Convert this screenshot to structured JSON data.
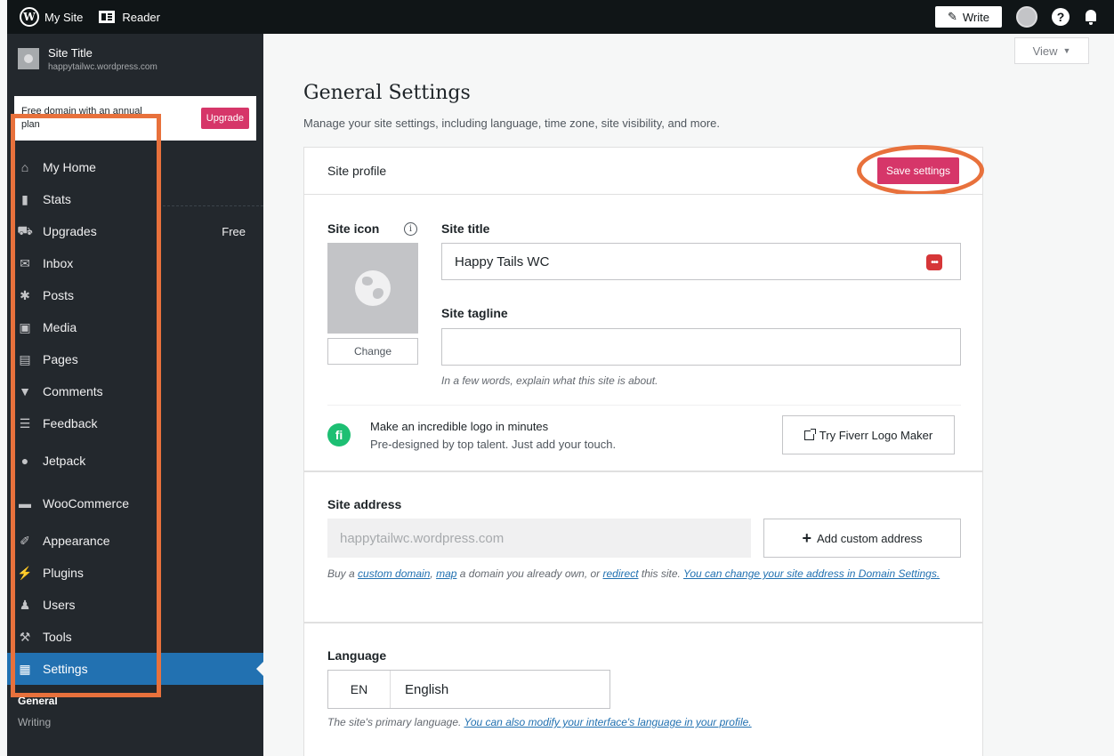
{
  "topbar": {
    "my_site": "My Site",
    "reader": "Reader",
    "write": "Write"
  },
  "site": {
    "title": "Site Title",
    "url": "happytailwc.wordpress.com"
  },
  "promo": {
    "text": "Free domain with an annual plan",
    "button": "Upgrade"
  },
  "menu": {
    "items": [
      {
        "label": "My Home",
        "icon": "home-icon"
      },
      {
        "label": "Stats",
        "icon": "stats-icon"
      },
      {
        "label": "Upgrades",
        "icon": "cart-icon",
        "badge": "Free"
      },
      {
        "label": "Inbox",
        "icon": "mail-icon"
      },
      {
        "label": "Posts",
        "icon": "pin-icon"
      },
      {
        "label": "Media",
        "icon": "media-icon"
      },
      {
        "label": "Pages",
        "icon": "pages-icon"
      },
      {
        "label": "Comments",
        "icon": "comment-icon"
      },
      {
        "label": "Feedback",
        "icon": "feedback-icon"
      },
      {
        "label": "Jetpack",
        "icon": "jetpack-icon"
      },
      {
        "label": "WooCommerce",
        "icon": "woo-icon"
      },
      {
        "label": "Appearance",
        "icon": "brush-icon"
      },
      {
        "label": "Plugins",
        "icon": "plug-icon"
      },
      {
        "label": "Users",
        "icon": "user-icon"
      },
      {
        "label": "Tools",
        "icon": "wrench-icon"
      },
      {
        "label": "Settings",
        "icon": "settings-icon"
      }
    ],
    "submenu": [
      "General",
      "Writing"
    ]
  },
  "main": {
    "view_button": "View",
    "title": "General Settings",
    "subtitle": "Manage your site settings, including language, time zone, site visibility, and more.",
    "profile_header": "Site profile",
    "save_button": "Save settings",
    "site_icon_label": "Site icon",
    "change_button": "Change",
    "site_title_label": "Site title",
    "site_title_value": "Happy Tails WC",
    "site_tagline_label": "Site tagline",
    "site_tagline_value": "",
    "tagline_hint": "In a few words, explain what this site is about.",
    "fiverr": {
      "title": "Make an incredible logo in minutes",
      "subtitle": "Pre-designed by top talent. Just add your touch.",
      "button": "Try Fiverr Logo Maker"
    },
    "address": {
      "label": "Site address",
      "value": "happytailwc.wordpress.com",
      "add_button": "Add custom address",
      "help_1": "Buy a ",
      "link_custom_domain": "custom domain",
      "help_2": ", ",
      "link_map": "map",
      "help_3": " a domain you already own, or ",
      "link_redirect": "redirect",
      "help_4": " this site. ",
      "link_domain_settings": "You can change your site address in Domain Settings."
    },
    "language": {
      "label": "Language",
      "code": "EN",
      "name": "English",
      "help": "The site's primary language. ",
      "link": "You can also modify your interface's language in your profile."
    }
  },
  "colors": {
    "accent_pink": "#d63669",
    "active_blue": "#2271b1",
    "highlight_orange": "#e8713c",
    "sidebar_bg": "#23282d"
  }
}
